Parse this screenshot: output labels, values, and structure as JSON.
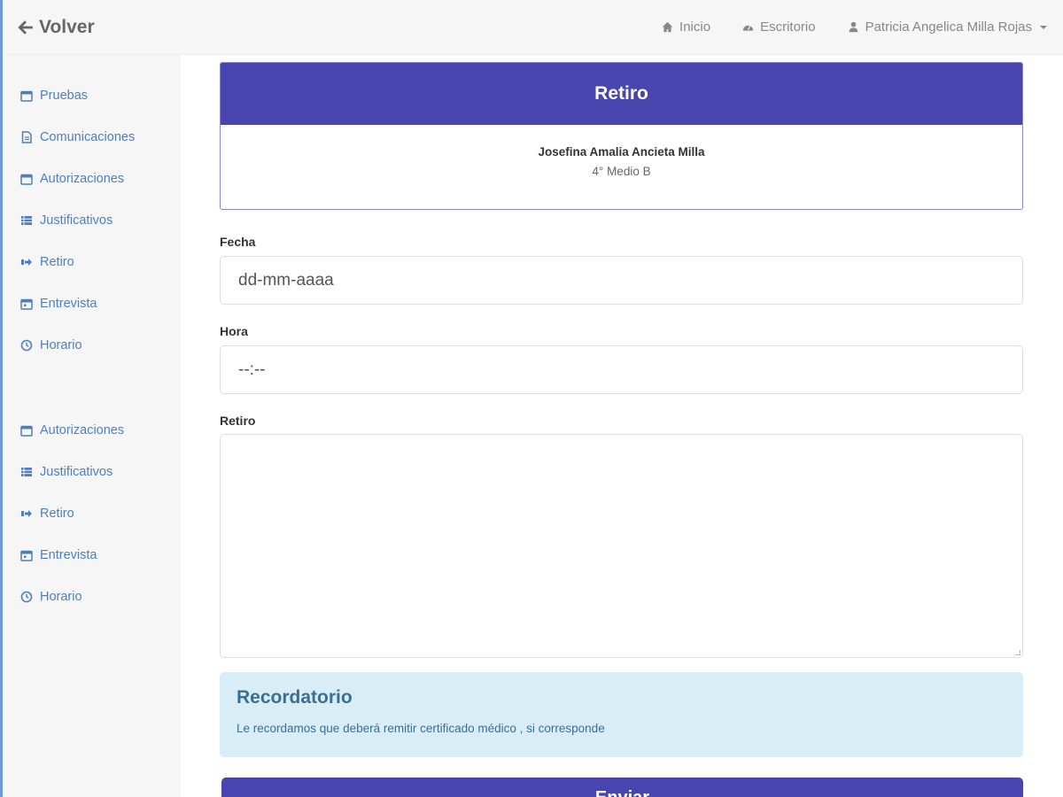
{
  "topbar": {
    "back_label": "Volver",
    "nav": [
      {
        "label": "Inicio",
        "icon": "home-icon"
      },
      {
        "label": "Escritorio",
        "icon": "dashboard-icon"
      },
      {
        "label": "Patricia Angelica Milla Rojas",
        "icon": "user-icon"
      }
    ]
  },
  "sidebar": {
    "group1": [
      {
        "label": "Pruebas",
        "icon": "calendar-icon"
      },
      {
        "label": "Comunicaciones",
        "icon": "document-icon"
      },
      {
        "label": "Autorizaciones",
        "icon": "calendar-icon"
      },
      {
        "label": "Justificativos",
        "icon": "list-icon"
      },
      {
        "label": "Retiro",
        "icon": "sign-out-icon"
      },
      {
        "label": "Entrevista",
        "icon": "calendar-icon"
      },
      {
        "label": "Horario",
        "icon": "clock-icon"
      }
    ],
    "group2": [
      {
        "label": "Autorizaciones",
        "icon": "calendar-icon"
      },
      {
        "label": "Justificativos",
        "icon": "list-icon"
      },
      {
        "label": "Retiro",
        "icon": "sign-out-icon"
      },
      {
        "label": "Entrevista",
        "icon": "calendar-icon"
      },
      {
        "label": "Horario",
        "icon": "clock-icon"
      }
    ]
  },
  "card": {
    "title": "Retiro",
    "student_name": "Josefina Amalia Ancieta Milla",
    "course": "4° Medio B"
  },
  "form": {
    "fecha_label": "Fecha",
    "fecha_placeholder": "dd-mm-aaaa",
    "hora_label": "Hora",
    "hora_placeholder": "--:--",
    "retiro_label": "Retiro",
    "retiro_value": ""
  },
  "alert": {
    "title": "Recordatorio",
    "text": "Le recordamos que deberá remitir certificado médico , si corresponde"
  },
  "submit_label": "Enviar",
  "colors": {
    "primary": "#4845ae",
    "link": "#4f7fb9",
    "alert_bg": "#d9edf7",
    "alert_text": "#3a6f92"
  }
}
